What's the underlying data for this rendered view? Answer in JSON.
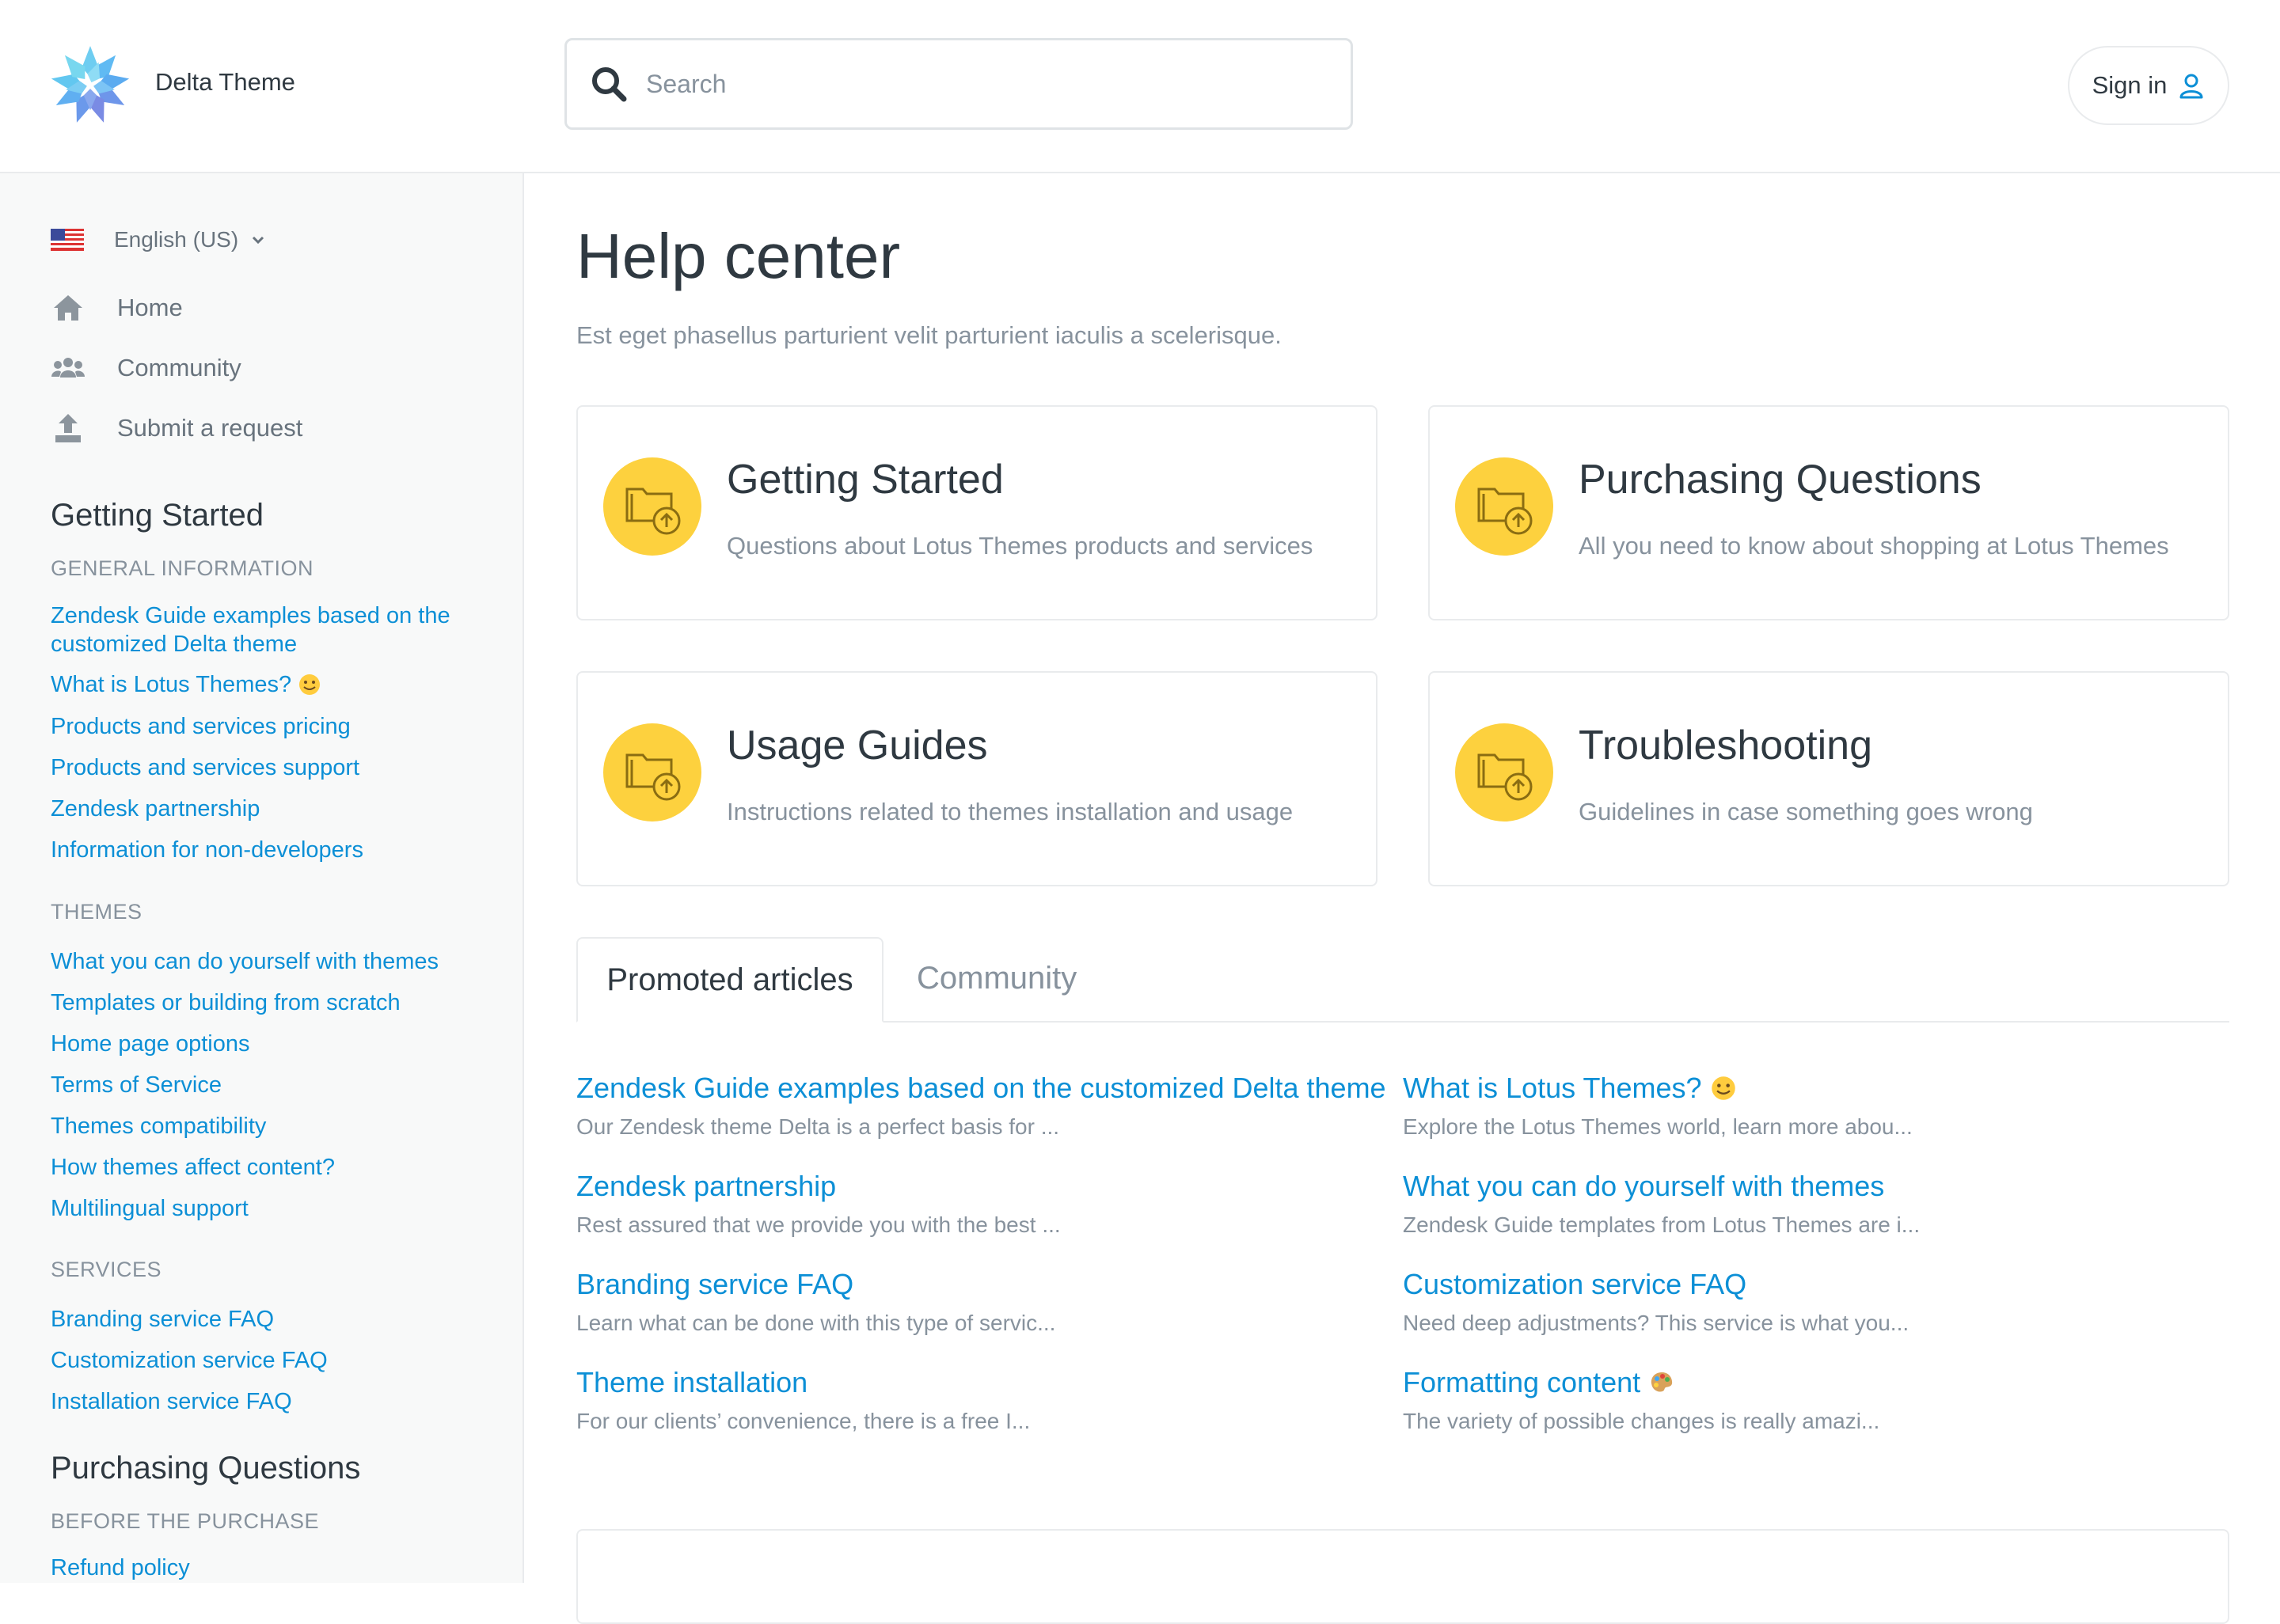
{
  "header": {
    "brand": "Delta Theme",
    "search_placeholder": "Search",
    "signin_label": "Sign in"
  },
  "sidebar": {
    "language": "English (US)",
    "nav": [
      {
        "label": "Home",
        "icon": "home-icon"
      },
      {
        "label": "Community",
        "icon": "community-icon"
      },
      {
        "label": "Submit a request",
        "icon": "upload-icon"
      }
    ],
    "sections": [
      {
        "title": "Getting Started",
        "groups": [
          {
            "caption": "GENERAL INFORMATION",
            "links": [
              "Zendesk Guide examples based on the customized Delta theme",
              "What is Lotus Themes?",
              "Products and services pricing",
              "Products and services support",
              "Zendesk partnership",
              "Information for non-developers"
            ]
          },
          {
            "caption": "THEMES",
            "links": [
              "What you can do yourself with themes",
              "Templates or building from scratch",
              "Home page options",
              "Terms of Service",
              "Themes compatibility",
              "How themes affect content?",
              "Multilingual support"
            ]
          },
          {
            "caption": "SERVICES",
            "links": [
              "Branding service FAQ",
              "Customization service FAQ",
              "Installation service FAQ"
            ]
          }
        ]
      },
      {
        "title": "Purchasing Questions",
        "groups": [
          {
            "caption": "BEFORE THE PURCHASE",
            "links": [
              "Refund policy"
            ]
          }
        ]
      }
    ]
  },
  "main": {
    "title": "Help center",
    "description": "Est eget phasellus parturient velit parturient iaculis a scelerisque.",
    "categories": [
      {
        "title": "Getting Started",
        "desc": "Questions about Lotus Themes products and services"
      },
      {
        "title": "Purchasing Questions",
        "desc": "All you need to know about shopping at Lotus Themes"
      },
      {
        "title": "Usage Guides",
        "desc": "Instructions related to themes installation and usage"
      },
      {
        "title": "Troubleshooting",
        "desc": "Guidelines in case something goes wrong"
      }
    ],
    "tabs": [
      "Promoted articles",
      "Community"
    ],
    "articles": [
      {
        "title": "Zendesk Guide examples based on the customized Delta theme",
        "snippet": "Our Zendesk theme Delta is a perfect basis for ..."
      },
      {
        "title": "What is Lotus Themes?",
        "snippet": "Explore the Lotus Themes world, learn more abou..."
      },
      {
        "title": "Zendesk partnership",
        "snippet": "Rest assured that we provide you with the best ..."
      },
      {
        "title": "What you can do yourself with themes",
        "snippet": "Zendesk Guide templates from Lotus Themes are i..."
      },
      {
        "title": "Branding service FAQ",
        "snippet": "Learn what can be done with this type of servic..."
      },
      {
        "title": "Customization service FAQ",
        "snippet": "Need deep adjustments? This service is what you..."
      },
      {
        "title": "Theme installation",
        "snippet": "For our clients’ convenience, there is a free I..."
      },
      {
        "title": "Formatting content",
        "snippet": "The variety of possible changes is really amazi..."
      }
    ]
  },
  "colors": {
    "link": "#0c8fd6",
    "muted": "#87929d",
    "heading": "#2f3941",
    "category_icon": "#fdd13e",
    "sidebar_bg": "#f8f9f9"
  }
}
